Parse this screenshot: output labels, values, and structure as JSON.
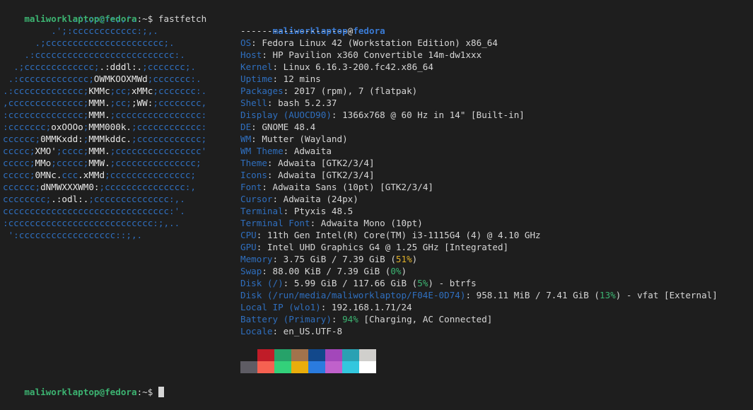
{
  "prompt": {
    "user_host": "maliworklaptop@fedora",
    "suffix": ":~$ ",
    "command": "fastfetch"
  },
  "logo_lines": [
    [
      {
        "t": "             .',;::::;,'.",
        "c": "blue"
      }
    ],
    [
      {
        "t": "         .';:cccccccccccc:;,.",
        "c": "blue"
      }
    ],
    [
      {
        "t": "      .;cccccccccccccccccccccc;.",
        "c": "blue"
      }
    ],
    [
      {
        "t": "    .:cccccccccccccccccccccccccc:.",
        "c": "blue"
      }
    ],
    [
      {
        "t": "  .;ccccccccccccc;",
        "c": "blue"
      },
      {
        "t": ".:dddl:.",
        "c": "white"
      },
      {
        "t": ";ccccccc;.",
        "c": "blue"
      }
    ],
    [
      {
        "t": " .:ccccccccccccc;",
        "c": "blue"
      },
      {
        "t": "OWMKOOXMWd",
        "c": "white"
      },
      {
        "t": ";ccccccc:.",
        "c": "blue"
      }
    ],
    [
      {
        "t": ".:ccccccccccccc;",
        "c": "blue"
      },
      {
        "t": "KMMc",
        "c": "white"
      },
      {
        "t": ";cc;",
        "c": "blue"
      },
      {
        "t": "xMMc",
        "c": "white"
      },
      {
        "t": ";ccccccc:.",
        "c": "blue"
      }
    ],
    [
      {
        "t": ",cccccccccccccc;",
        "c": "blue"
      },
      {
        "t": "MMM.",
        "c": "white"
      },
      {
        "t": ";cc;",
        "c": "blue"
      },
      {
        "t": ";WW:",
        "c": "white"
      },
      {
        "t": ";cccccccc,",
        "c": "blue"
      }
    ],
    [
      {
        "t": ":cccccccccccccc;",
        "c": "blue"
      },
      {
        "t": "MMM.",
        "c": "white"
      },
      {
        "t": ";cccccccccccccccc:",
        "c": "blue"
      }
    ],
    [
      {
        "t": ":ccccccc;",
        "c": "blue"
      },
      {
        "t": "oxOOOo",
        "c": "white"
      },
      {
        "t": ";",
        "c": "blue"
      },
      {
        "t": "MMM000k.",
        "c": "white"
      },
      {
        "t": ";cccccccccccc:",
        "c": "blue"
      }
    ],
    [
      {
        "t": "cccccc;",
        "c": "blue"
      },
      {
        "t": "0MMKxdd:",
        "c": "white"
      },
      {
        "t": ";",
        "c": "blue"
      },
      {
        "t": "MMMkddc.",
        "c": "white"
      },
      {
        "t": ";cccccccccccc;",
        "c": "blue"
      }
    ],
    [
      {
        "t": "ccccc;",
        "c": "blue"
      },
      {
        "t": "XMO'",
        "c": "white"
      },
      {
        "t": ";cccc;",
        "c": "blue"
      },
      {
        "t": "MMM.",
        "c": "white"
      },
      {
        "t": ";cccccccccccccccc'",
        "c": "blue"
      }
    ],
    [
      {
        "t": "ccccc;",
        "c": "blue"
      },
      {
        "t": "MMo",
        "c": "white"
      },
      {
        "t": ";ccccc;",
        "c": "blue"
      },
      {
        "t": "MMW.",
        "c": "white"
      },
      {
        "t": ";ccccccccccccccc;",
        "c": "blue"
      }
    ],
    [
      {
        "t": "ccccc;",
        "c": "blue"
      },
      {
        "t": "0MNc.",
        "c": "white"
      },
      {
        "t": "ccc",
        "c": "blue"
      },
      {
        "t": ".xMMd",
        "c": "white"
      },
      {
        "t": ";ccccccccccccccc;",
        "c": "blue"
      }
    ],
    [
      {
        "t": "cccccc;",
        "c": "blue"
      },
      {
        "t": "dNMWXXXWM0:",
        "c": "white"
      },
      {
        "t": ";ccccccccccccccc:,",
        "c": "blue"
      }
    ],
    [
      {
        "t": "cccccccc;",
        "c": "blue"
      },
      {
        "t": ".:odl:.",
        "c": "white"
      },
      {
        "t": ";cccccccccccccc:,.",
        "c": "blue"
      }
    ],
    [
      {
        "t": "ccccccccccccccccccccccccccccccc:'.",
        "c": "blue"
      }
    ],
    [
      {
        "t": ":ccccccccccccccccccccccccccc:;,..",
        "c": "blue"
      }
    ],
    [
      {
        "t": " ':cccccccccccccccccc::;,.",
        "c": "blue"
      }
    ]
  ],
  "title": {
    "user": "maliworklaptop",
    "at": "@",
    "host": "fedora"
  },
  "separator": "---------------------",
  "info": [
    {
      "key": "OS",
      "parts": [
        {
          "t": "Fedora Linux 42 (Workstation Edition) x86_64"
        }
      ]
    },
    {
      "key": "Host",
      "parts": [
        {
          "t": "HP Pavilion x360 Convertible 14m-dw1xxx"
        }
      ]
    },
    {
      "key": "Kernel",
      "parts": [
        {
          "t": "Linux 6.16.3-200.fc42.x86_64"
        }
      ]
    },
    {
      "key": "Uptime",
      "parts": [
        {
          "t": "12 mins"
        }
      ]
    },
    {
      "key": "Packages",
      "parts": [
        {
          "t": "2017 (rpm), 7 (flatpak)"
        }
      ]
    },
    {
      "key": "Shell",
      "parts": [
        {
          "t": "bash 5.2.37"
        }
      ]
    },
    {
      "key": "Display (AUOCD90)",
      "parts": [
        {
          "t": "1366x768 @ 60 Hz in 14\" [Built-in]"
        }
      ]
    },
    {
      "key": "DE",
      "parts": [
        {
          "t": "GNOME 48.4"
        }
      ]
    },
    {
      "key": "WM",
      "parts": [
        {
          "t": "Mutter (Wayland)"
        }
      ]
    },
    {
      "key": "WM Theme",
      "parts": [
        {
          "t": "Adwaita"
        }
      ]
    },
    {
      "key": "Theme",
      "parts": [
        {
          "t": "Adwaita [GTK2/3/4]"
        }
      ]
    },
    {
      "key": "Icons",
      "parts": [
        {
          "t": "Adwaita [GTK2/3/4]"
        }
      ]
    },
    {
      "key": "Font",
      "parts": [
        {
          "t": "Adwaita Sans (10pt) [GTK2/3/4]"
        }
      ]
    },
    {
      "key": "Cursor",
      "parts": [
        {
          "t": "Adwaita (24px)"
        }
      ]
    },
    {
      "key": "Terminal",
      "parts": [
        {
          "t": "Ptyxis 48.5"
        }
      ]
    },
    {
      "key": "Terminal Font",
      "parts": [
        {
          "t": "Adwaita Mono (10pt)"
        }
      ]
    },
    {
      "key": "CPU",
      "parts": [
        {
          "t": "11th Gen Intel(R) Core(TM) i3-1115G4 (4) @ 4.10 GHz"
        }
      ]
    },
    {
      "key": "GPU",
      "parts": [
        {
          "t": "Intel UHD Graphics G4 @ 1.25 GHz [Integrated]"
        }
      ]
    },
    {
      "key": "Memory",
      "parts": [
        {
          "t": "3.75 GiB / 7.39 GiB ("
        },
        {
          "t": "51%",
          "c": "pct-yellow"
        },
        {
          "t": ")"
        }
      ]
    },
    {
      "key": "Swap",
      "parts": [
        {
          "t": "88.00 KiB / 7.39 GiB ("
        },
        {
          "t": "0%",
          "c": "pct-green"
        },
        {
          "t": ")"
        }
      ]
    },
    {
      "key": "Disk (/)",
      "parts": [
        {
          "t": "5.99 GiB / 117.66 GiB ("
        },
        {
          "t": "5%",
          "c": "pct-green"
        },
        {
          "t": ") - btrfs"
        }
      ]
    },
    {
      "key": "Disk (/run/media/maliworklaptop/F04E-0D74)",
      "parts": [
        {
          "t": "958.11 MiB / 7.41 GiB ("
        },
        {
          "t": "13%",
          "c": "pct-green"
        },
        {
          "t": ") - vfat [External]"
        }
      ]
    },
    {
      "key": "Local IP (wlo1)",
      "parts": [
        {
          "t": "192.168.1.71/24"
        }
      ]
    },
    {
      "key": "Battery (Primary)",
      "parts": [
        {
          "t": "94%",
          "c": "pct-green"
        },
        {
          "t": " [Charging, AC Connected]"
        }
      ]
    },
    {
      "key": "Locale",
      "parts": [
        {
          "t": "en_US.UTF-8"
        }
      ]
    }
  ],
  "palette": {
    "normal": [
      "#1e1e1e",
      "#c01c28",
      "#26a269",
      "#a2734c",
      "#12488b",
      "#a347ba",
      "#2aa1b3",
      "#d0cfcc"
    ],
    "bright": [
      "#5e5c64",
      "#f66151",
      "#33d17a",
      "#e9ad0c",
      "#2a7bde",
      "#c061cb",
      "#33c7de",
      "#ffffff"
    ]
  },
  "colors": {
    "background": "#1e1e1e",
    "prompt_green": "#3cb371",
    "key_blue": "#2f6fbf",
    "warn_yellow": "#e0b12a"
  }
}
